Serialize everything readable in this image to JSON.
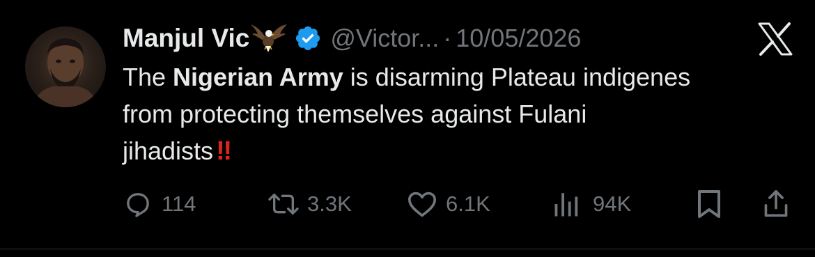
{
  "tweet": {
    "display_name": "Manjul Vic",
    "handle": "@Victor...",
    "separator": "·",
    "date": "10/05/2026",
    "text_lines": [
      {
        "before": "The ",
        "bold": "Nigerian Army",
        "after": " is disarming Plateau indigenes"
      },
      {
        "text": "from protecting themselves against Fulani"
      },
      {
        "text": "jihadists",
        "emoji": "‼"
      }
    ]
  },
  "actions": {
    "replies": "114",
    "reposts": "3.3K",
    "likes": "6.1K",
    "views": "94K"
  },
  "icons": {
    "avatar": "profile-photo",
    "name_emoji": "eagle-icon",
    "verified": "verified-badge-icon",
    "platform": "x-logo-icon",
    "reply": "reply-icon",
    "repost": "repost-icon",
    "like": "heart-icon",
    "views": "views-icon",
    "bookmark": "bookmark-icon",
    "share": "share-icon"
  },
  "colors": {
    "background": "#000000",
    "text": "#e7e9ea",
    "secondary": "#71767b",
    "verified": "#1d9bf0",
    "emoji_red": "#e0241b"
  }
}
